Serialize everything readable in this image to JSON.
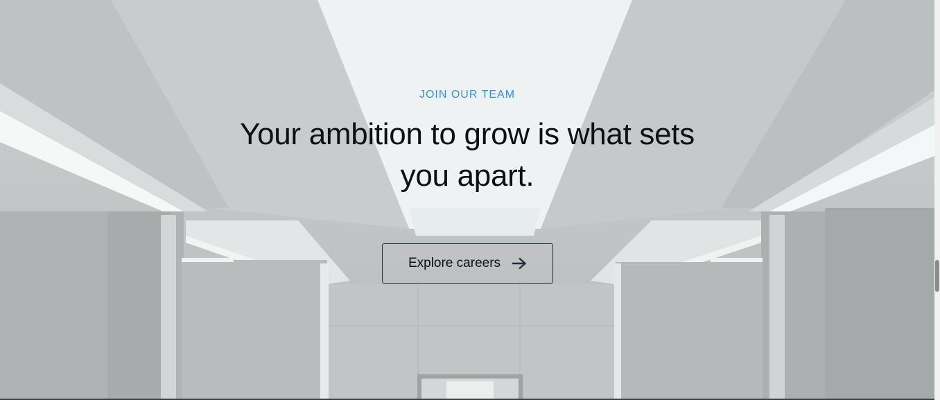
{
  "hero": {
    "eyebrow": "JOIN OUR TEAM",
    "headline": "Your ambition to grow is what sets you apart.",
    "cta_label": "Explore careers",
    "cta_icon": "arrow-right-icon",
    "background": "corridor-photo"
  },
  "colors": {
    "eyebrow": "#2f93e6",
    "headline": "#0e0f12",
    "cta_border": "#1f2d3d"
  }
}
